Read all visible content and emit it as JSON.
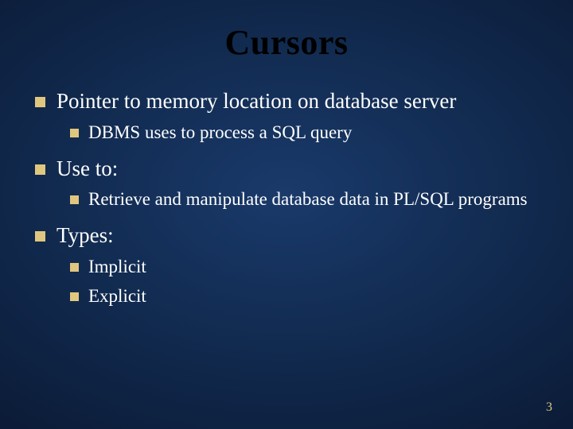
{
  "title": "Cursors",
  "bullets": {
    "b1": "Pointer to memory location on database server",
    "b1_1": "DBMS uses to process a SQL query",
    "b2": "Use to:",
    "b2_1": "Retrieve and manipulate database data in PL/SQL programs",
    "b3": "Types:",
    "b3_1": "Implicit",
    "b3_2": "Explicit"
  },
  "page_number": "3"
}
